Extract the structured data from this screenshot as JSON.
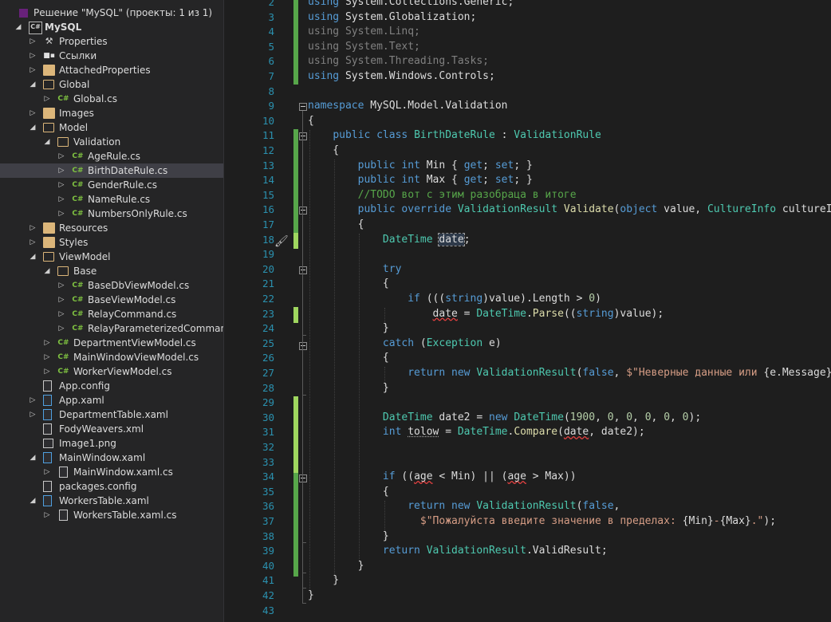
{
  "explorer": {
    "solution_label": "Решение \"MySQL\" (проекты: 1 из 1)",
    "items": [
      {
        "label": "MySQL",
        "icon": "csharp-project-icon",
        "depth": 0,
        "arrow": "open",
        "bold": true
      },
      {
        "label": "Properties",
        "icon": "wrench-icon",
        "depth": 1,
        "arrow": "closed"
      },
      {
        "label": "Ссылки",
        "icon": "references-icon",
        "depth": 1,
        "arrow": "closed"
      },
      {
        "label": "AttachedProperties",
        "icon": "folder-icon",
        "depth": 1,
        "arrow": "closed"
      },
      {
        "label": "Global",
        "icon": "folder-open-icon",
        "depth": 1,
        "arrow": "open"
      },
      {
        "label": "Global.cs",
        "icon": "csharp-file-icon",
        "depth": 2,
        "arrow": "closed"
      },
      {
        "label": "Images",
        "icon": "folder-icon",
        "depth": 1,
        "arrow": "closed"
      },
      {
        "label": "Model",
        "icon": "folder-open-icon",
        "depth": 1,
        "arrow": "open"
      },
      {
        "label": "Validation",
        "icon": "folder-open-icon",
        "depth": 2,
        "arrow": "open"
      },
      {
        "label": "AgeRule.cs",
        "icon": "csharp-file-icon",
        "depth": 3,
        "arrow": "closed"
      },
      {
        "label": "BirthDateRule.cs",
        "icon": "csharp-file-icon",
        "depth": 3,
        "arrow": "closed",
        "selected": true
      },
      {
        "label": "GenderRule.cs",
        "icon": "csharp-file-icon",
        "depth": 3,
        "arrow": "closed"
      },
      {
        "label": "NameRule.cs",
        "icon": "csharp-file-icon",
        "depth": 3,
        "arrow": "closed"
      },
      {
        "label": "NumbersOnlyRule.cs",
        "icon": "csharp-file-icon",
        "depth": 3,
        "arrow": "closed"
      },
      {
        "label": "Resources",
        "icon": "folder-icon",
        "depth": 1,
        "arrow": "closed"
      },
      {
        "label": "Styles",
        "icon": "folder-icon",
        "depth": 1,
        "arrow": "closed"
      },
      {
        "label": "ViewModel",
        "icon": "folder-open-icon",
        "depth": 1,
        "arrow": "open"
      },
      {
        "label": "Base",
        "icon": "folder-open-icon",
        "depth": 2,
        "arrow": "open"
      },
      {
        "label": "BaseDbViewModel.cs",
        "icon": "csharp-file-icon",
        "depth": 3,
        "arrow": "closed"
      },
      {
        "label": "BaseViewModel.cs",
        "icon": "csharp-file-icon",
        "depth": 3,
        "arrow": "closed"
      },
      {
        "label": "RelayCommand.cs",
        "icon": "csharp-file-icon",
        "depth": 3,
        "arrow": "closed"
      },
      {
        "label": "RelayParameterizedCommand.",
        "icon": "csharp-file-icon",
        "depth": 3,
        "arrow": "closed"
      },
      {
        "label": "DepartmentViewModel.cs",
        "icon": "csharp-file-icon",
        "depth": 2,
        "arrow": "closed"
      },
      {
        "label": "MainWindowViewModel.cs",
        "icon": "csharp-file-icon",
        "depth": 2,
        "arrow": "closed"
      },
      {
        "label": "WorkerViewModel.cs",
        "icon": "csharp-file-icon",
        "depth": 2,
        "arrow": "closed"
      },
      {
        "label": "App.config",
        "icon": "config-file-icon",
        "depth": 1,
        "arrow": "none"
      },
      {
        "label": "App.xaml",
        "icon": "xaml-file-icon",
        "depth": 1,
        "arrow": "closed"
      },
      {
        "label": "DepartmentTable.xaml",
        "icon": "xaml-file-icon",
        "depth": 1,
        "arrow": "closed"
      },
      {
        "label": "FodyWeavers.xml",
        "icon": "xml-file-icon",
        "depth": 1,
        "arrow": "none"
      },
      {
        "label": "Image1.png",
        "icon": "image-file-icon",
        "depth": 1,
        "arrow": "none"
      },
      {
        "label": "MainWindow.xaml",
        "icon": "xaml-file-icon",
        "depth": 1,
        "arrow": "open"
      },
      {
        "label": "MainWindow.xaml.cs",
        "icon": "csharp-file-icon",
        "depth": 2,
        "arrow": "closed",
        "xamlcs": true
      },
      {
        "label": "packages.config",
        "icon": "config-file-icon",
        "depth": 1,
        "arrow": "none"
      },
      {
        "label": "WorkersTable.xaml",
        "icon": "xaml-file-icon",
        "depth": 1,
        "arrow": "open"
      },
      {
        "label": "WorkersTable.xaml.cs",
        "icon": "csharp-file-icon",
        "depth": 2,
        "arrow": "closed",
        "xamlcs": true
      }
    ]
  },
  "editor": {
    "line_numbers": [
      "2",
      "3",
      "4",
      "5",
      "6",
      "7",
      "8",
      "9",
      "10",
      "11",
      "12",
      "13",
      "14",
      "15",
      "16",
      "17",
      "18",
      "19",
      "20",
      "21",
      "22",
      "23",
      "24",
      "25",
      "26",
      "27",
      "28",
      "29",
      "30",
      "31",
      "32",
      "33",
      "34",
      "35",
      "36",
      "37",
      "38",
      "39",
      "40",
      "41",
      "42",
      "43"
    ],
    "lines": [
      [
        [
          "k",
          "using "
        ],
        [
          "",
          "System.Collections.Generic;"
        ]
      ],
      [
        [
          "k",
          "using "
        ],
        [
          "",
          "System.Globalization;"
        ]
      ],
      [
        [
          "u",
          "using System.Linq;"
        ]
      ],
      [
        [
          "u",
          "using System.Text;"
        ]
      ],
      [
        [
          "u",
          "using System.Threading.Tasks;"
        ]
      ],
      [
        [
          "k",
          "using "
        ],
        [
          "",
          "System.Windows.Controls;"
        ]
      ],
      [],
      [
        [
          "k",
          "namespace "
        ],
        [
          "",
          "MySQL.Model.Validation"
        ]
      ],
      [
        [
          "",
          "{"
        ]
      ],
      [
        [
          "",
          "    "
        ],
        [
          "k",
          "public class "
        ],
        [
          "t",
          "BirthDateRule"
        ],
        [
          "",
          " : "
        ],
        [
          "t",
          "ValidationRule"
        ]
      ],
      [
        [
          "",
          "    {"
        ]
      ],
      [
        [
          "",
          "        "
        ],
        [
          "k",
          "public int "
        ],
        [
          "",
          "Min { "
        ],
        [
          "k",
          "get"
        ],
        [
          "",
          "; "
        ],
        [
          "k",
          "set"
        ],
        [
          "",
          "; }"
        ]
      ],
      [
        [
          "",
          "        "
        ],
        [
          "k",
          "public int "
        ],
        [
          "",
          "Max { "
        ],
        [
          "k",
          "get"
        ],
        [
          "",
          "; "
        ],
        [
          "k",
          "set"
        ],
        [
          "",
          "; }"
        ]
      ],
      [
        [
          "",
          "        "
        ],
        [
          "c",
          "//TODO вот с этим разобраца в итоге"
        ]
      ],
      [
        [
          "",
          "        "
        ],
        [
          "k",
          "public override "
        ],
        [
          "t",
          "ValidationResult "
        ],
        [
          "m",
          "Validate"
        ],
        [
          "",
          "("
        ],
        [
          "k",
          "object "
        ],
        [
          "",
          "value, "
        ],
        [
          "t",
          "CultureInfo "
        ],
        [
          "",
          "cultureInfo)"
        ]
      ],
      [
        [
          "",
          "        {"
        ]
      ],
      [
        [
          "",
          "            "
        ],
        [
          "t",
          "DateTime "
        ],
        [
          "hl",
          "date"
        ],
        [
          "",
          ";"
        ]
      ],
      [],
      [
        [
          "",
          "            "
        ],
        [
          "k",
          "try"
        ]
      ],
      [
        [
          "",
          "            {"
        ]
      ],
      [
        [
          "",
          "                "
        ],
        [
          "k",
          "if "
        ],
        [
          "",
          "((("
        ],
        [
          "k",
          "string"
        ],
        [
          "",
          ")value).Length > "
        ],
        [
          "n",
          "0"
        ],
        [
          "",
          ")"
        ]
      ],
      [
        [
          "",
          "                    "
        ],
        [
          "err",
          "date"
        ],
        [
          "",
          " = "
        ],
        [
          "t",
          "DateTime"
        ],
        [
          "",
          "."
        ],
        [
          "m",
          "Parse"
        ],
        [
          "",
          "(("
        ],
        [
          "k",
          "string"
        ],
        [
          "",
          ")value);"
        ]
      ],
      [
        [
          "",
          "            }"
        ]
      ],
      [
        [
          "",
          "            "
        ],
        [
          "k",
          "catch "
        ],
        [
          "",
          "("
        ],
        [
          "t",
          "Exception "
        ],
        [
          "",
          "e)"
        ]
      ],
      [
        [
          "",
          "            {"
        ]
      ],
      [
        [
          "",
          "                "
        ],
        [
          "k",
          "return new "
        ],
        [
          "t",
          "ValidationResult"
        ],
        [
          "",
          "("
        ],
        [
          "k",
          "false"
        ],
        [
          "",
          ", "
        ],
        [
          "s",
          "$\"Неверные данные или "
        ],
        [
          "",
          "{e.Message}"
        ],
        [
          "s",
          "\""
        ],
        [
          "",
          ");"
        ]
      ],
      [
        [
          "",
          "            }"
        ]
      ],
      [],
      [
        [
          "",
          "            "
        ],
        [
          "t",
          "DateTime "
        ],
        [
          "",
          "date2 = "
        ],
        [
          "k",
          "new "
        ],
        [
          "t",
          "DateTime"
        ],
        [
          "",
          "("
        ],
        [
          "n",
          "1900"
        ],
        [
          "",
          ", "
        ],
        [
          "n",
          "0"
        ],
        [
          "",
          ", "
        ],
        [
          "n",
          "0"
        ],
        [
          "",
          ", "
        ],
        [
          "n",
          "0"
        ],
        [
          "",
          ", "
        ],
        [
          "n",
          "0"
        ],
        [
          "",
          ", "
        ],
        [
          "n",
          "0"
        ],
        [
          "",
          ");"
        ]
      ],
      [
        [
          "",
          "            "
        ],
        [
          "k",
          "int "
        ],
        [
          "warn",
          "tolow"
        ],
        [
          "",
          " = "
        ],
        [
          "t",
          "DateTime"
        ],
        [
          "",
          "."
        ],
        [
          "m",
          "Compare"
        ],
        [
          "",
          "("
        ],
        [
          "err",
          "date"
        ],
        [
          "",
          ", date2);"
        ]
      ],
      [],
      [],
      [
        [
          "",
          "            "
        ],
        [
          "k",
          "if "
        ],
        [
          "",
          "(("
        ],
        [
          "err",
          "age"
        ],
        [
          "",
          " < Min) || ("
        ],
        [
          "err",
          "age"
        ],
        [
          "",
          " > Max))"
        ]
      ],
      [
        [
          "",
          "            {"
        ]
      ],
      [
        [
          "",
          "                "
        ],
        [
          "k",
          "return new "
        ],
        [
          "t",
          "ValidationResult"
        ],
        [
          "",
          "("
        ],
        [
          "k",
          "false"
        ],
        [
          "",
          ","
        ]
      ],
      [
        [
          "",
          "                  "
        ],
        [
          "s",
          "$\"Пожалуйста введите значение в пределах: "
        ],
        [
          "",
          "{Min}"
        ],
        [
          "s",
          "-"
        ],
        [
          "",
          "{Max}"
        ],
        [
          "s",
          ".\""
        ],
        [
          "",
          ");"
        ]
      ],
      [
        [
          "",
          "            }"
        ]
      ],
      [
        [
          "",
          "            "
        ],
        [
          "k",
          "return "
        ],
        [
          "t",
          "ValidationResult"
        ],
        [
          "",
          ".ValidResult;"
        ]
      ],
      [
        [
          "",
          "        }"
        ]
      ],
      [
        [
          "",
          "    }"
        ]
      ],
      [
        [
          "",
          "}"
        ]
      ],
      []
    ]
  },
  "colors": {
    "keyword": "#569cd6",
    "type": "#4ec9b0",
    "string": "#d69d85",
    "comment": "#57a64a",
    "number": "#b5cea8",
    "method": "#dcdcaa",
    "line_number": "#2b91af",
    "change_saved": "#57a64a",
    "change_unsaved": "#9fd65f",
    "editor_bg": "#1e1e1e",
    "explorer_bg": "#252526"
  }
}
